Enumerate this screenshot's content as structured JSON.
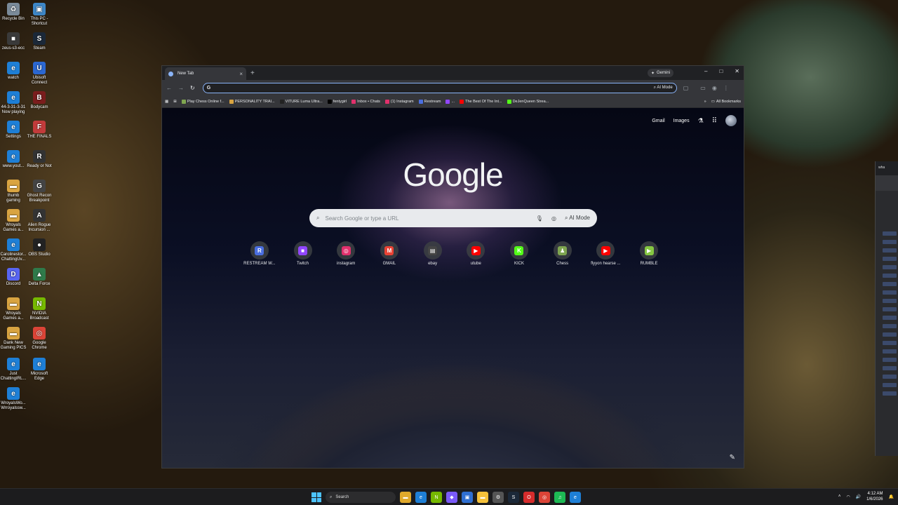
{
  "desktop": {
    "icons": [
      {
        "label": "Recycle Bin",
        "color": "#7a8a99",
        "glyph": "♻"
      },
      {
        "label": "This PC - Shortcut",
        "color": "#3d86c6",
        "glyph": "▣"
      },
      {
        "label": "zeus-s3-ecc",
        "color": "#3a3a3a",
        "glyph": "■"
      },
      {
        "label": "Steam",
        "color": "#1b2838",
        "glyph": "S"
      },
      {
        "label": "watch",
        "color": "#1e7fd6",
        "glyph": "e"
      },
      {
        "label": "Ubisoft Connect",
        "color": "#2b67d1",
        "glyph": "U"
      },
      {
        "label": "44-3-31-3-31 Now playing",
        "color": "#1e7fd6",
        "glyph": "e"
      },
      {
        "label": "Bodycam",
        "color": "#7a1d1d",
        "glyph": "B"
      },
      {
        "label": "Settings",
        "color": "#1e7fd6",
        "glyph": "e"
      },
      {
        "label": "THE FINALS",
        "color": "#c23b3b",
        "glyph": "F"
      },
      {
        "label": "www.yout...",
        "color": "#1e7fd6",
        "glyph": "e"
      },
      {
        "label": "Ready or Not",
        "color": "#333",
        "glyph": "R"
      },
      {
        "label": "thumb gaming",
        "color": "#d9a441",
        "glyph": "▬"
      },
      {
        "label": "Ghost Recon Breakpoint",
        "color": "#444",
        "glyph": "G"
      },
      {
        "label": "Wroyals Games a...",
        "color": "#d9a441",
        "glyph": "▬"
      },
      {
        "label": "Alien Rogue Incursion ...",
        "color": "#333",
        "glyph": "A"
      },
      {
        "label": "Carolinestor... ChattingUv...",
        "color": "#1e7fd6",
        "glyph": "e"
      },
      {
        "label": "OBS Studio",
        "color": "#222",
        "glyph": "●"
      },
      {
        "label": "Discord",
        "color": "#5865f2",
        "glyph": "D"
      },
      {
        "label": "Delta Force",
        "color": "#2f7a4a",
        "glyph": "▲"
      },
      {
        "label": "Wroyals Games a...",
        "color": "#d9a441",
        "glyph": "▬"
      },
      {
        "label": "NVIDIA Broadcast",
        "color": "#76b900",
        "glyph": "N"
      },
      {
        "label": "Dank New Gaming PICS",
        "color": "#d9a441",
        "glyph": "▬"
      },
      {
        "label": "Google Chrome",
        "color": "#db4437",
        "glyph": "◎"
      },
      {
        "label": "Just ChattingIRL...",
        "color": "#1e7fd6",
        "glyph": "e"
      },
      {
        "label": "Microsoft Edge",
        "color": "#1e7fd6",
        "glyph": "e"
      },
      {
        "label": "WroyalsWo... Wrroyalssw...",
        "color": "#1e7fd6",
        "glyph": "e"
      }
    ]
  },
  "browser": {
    "tab": {
      "title": "New Tab",
      "close": "×"
    },
    "new_tab": "+",
    "gemini_label": "Gemini",
    "window_controls": {
      "minimize": "–",
      "maximize": "□",
      "close": "✕"
    },
    "nav": {
      "back": "←",
      "forward": "→",
      "reload": "↻"
    },
    "omnibox": {
      "value": "",
      "g_badge": "G",
      "ai_mode": "AI Mode"
    },
    "bookmarks": [
      {
        "label": "Play Chess Online f...",
        "color": "#7fa650"
      },
      {
        "label": "PERSONALITY TRAI...",
        "color": "#d9a441"
      },
      {
        "label": "VITURE Luma Ultra...",
        "color": "#222"
      },
      {
        "label": "fentygirl",
        "color": "#000"
      },
      {
        "label": "Inbox • Chats",
        "color": "#e1306c"
      },
      {
        "label": "(1) Instagram",
        "color": "#e1306c"
      },
      {
        "label": "Restream",
        "color": "#4a6ee0"
      },
      {
        "label": "...",
        "color": "#9146ff"
      },
      {
        "label": "The Best Of The Int...",
        "color": "#ff0000"
      },
      {
        "label": "DeJenQueen Strea...",
        "color": "#53fc18"
      }
    ],
    "all_bookmarks": "All Bookmarks"
  },
  "ntp": {
    "links": {
      "gmail": "Gmail",
      "images": "Images"
    },
    "logo": "Google",
    "search_placeholder": "Search Google or type a URL",
    "search_ai_mode": "AI Mode",
    "shortcuts": [
      {
        "label": "RESTREAM W...",
        "color": "#4a6ee0",
        "glyph": "R"
      },
      {
        "label": "Twitch",
        "color": "#9146ff",
        "glyph": "■"
      },
      {
        "label": "instagram",
        "color": "#e1306c",
        "glyph": "◎"
      },
      {
        "label": "GMAIL",
        "color": "#ea4335",
        "glyph": "M"
      },
      {
        "label": "ebay",
        "color": "#444",
        "glyph": "▤"
      },
      {
        "label": "utube",
        "color": "#ff0000",
        "glyph": "▶"
      },
      {
        "label": "KICK",
        "color": "#53fc18",
        "glyph": "K"
      },
      {
        "label": "Chess",
        "color": "#7fa650",
        "glyph": "♟"
      },
      {
        "label": "flyyon hearse ...",
        "color": "#ff0000",
        "glyph": "▶"
      },
      {
        "label": "RUMBLE",
        "color": "#85c742",
        "glyph": "▶"
      }
    ]
  },
  "peek_window": {
    "tab": "wha"
  },
  "taskbar": {
    "search_placeholder": "Search",
    "apps": [
      {
        "name": "file-explorer",
        "color": "#e0a92b",
        "glyph": "▬"
      },
      {
        "name": "edge",
        "color": "#1e7fd6",
        "glyph": "e"
      },
      {
        "name": "nvidia",
        "color": "#76b900",
        "glyph": "N"
      },
      {
        "name": "copilot",
        "color": "#7a5af8",
        "glyph": "◆"
      },
      {
        "name": "store",
        "color": "#2f6fd1",
        "glyph": "▣"
      },
      {
        "name": "explorer",
        "color": "#f5c13a",
        "glyph": "▬"
      },
      {
        "name": "settings",
        "color": "#555",
        "glyph": "⚙"
      },
      {
        "name": "steam",
        "color": "#1b2838",
        "glyph": "S"
      },
      {
        "name": "opera",
        "color": "#d62c2c",
        "glyph": "O"
      },
      {
        "name": "chrome",
        "color": "#db4437",
        "glyph": "◎"
      },
      {
        "name": "spotify",
        "color": "#1db954",
        "glyph": "♫"
      },
      {
        "name": "edge-dev",
        "color": "#1e7fd6",
        "glyph": "e"
      }
    ],
    "time": "4:12 AM",
    "date": "1/6/2026"
  }
}
